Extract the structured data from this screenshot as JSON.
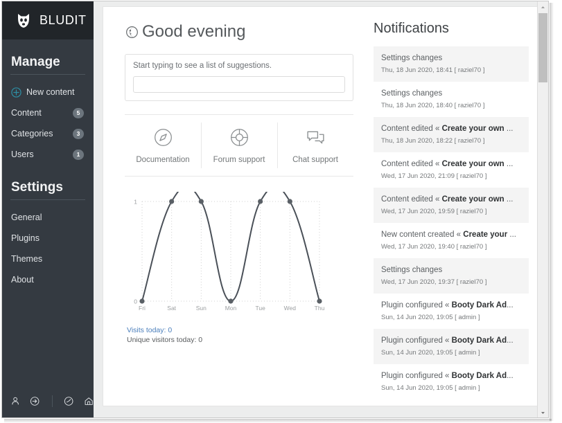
{
  "brand": {
    "name": "BLUDIT",
    "logo_icon": "dog-head-icon"
  },
  "sidebar": {
    "manage": {
      "title": "Manage",
      "items": [
        {
          "label": "New content",
          "icon": "plus-circle-icon",
          "badge": null,
          "accent": "#2d8fa5"
        },
        {
          "label": "Content",
          "icon": null,
          "badge": "5"
        },
        {
          "label": "Categories",
          "icon": null,
          "badge": "3"
        },
        {
          "label": "Users",
          "icon": null,
          "badge": "1"
        }
      ]
    },
    "settings": {
      "title": "Settings",
      "items": [
        {
          "label": "General"
        },
        {
          "label": "Plugins"
        },
        {
          "label": "Themes"
        },
        {
          "label": "About"
        }
      ]
    },
    "footer_icons": [
      {
        "name": "user-icon"
      },
      {
        "name": "logout-icon"
      },
      {
        "name": "divider"
      },
      {
        "name": "dashboard-icon"
      },
      {
        "name": "home-icon"
      }
    ]
  },
  "main": {
    "greeting": "Good evening",
    "greeting_icon": "moon-icon",
    "search": {
      "label": "Start typing to see a list of suggestions.",
      "value": "",
      "placeholder": ""
    },
    "support": [
      {
        "label": "Documentation",
        "icon": "compass-icon"
      },
      {
        "label": "Forum support",
        "icon": "life-ring-icon"
      },
      {
        "label": "Chat support",
        "icon": "chat-bubbles-icon"
      }
    ],
    "stats": {
      "visits_today": "Visits today: 0",
      "unique_today": "Unique visitors today: 0"
    }
  },
  "chart_data": {
    "type": "line",
    "title": "",
    "xlabel": "",
    "ylabel": "",
    "categories": [
      "Fri",
      "Sat",
      "Sun",
      "Mon",
      "Tue",
      "Wed",
      "Thu"
    ],
    "values": [
      0,
      1,
      1,
      0,
      1,
      1,
      0
    ],
    "ylim": [
      0,
      1
    ],
    "ytick_labels": [
      "0",
      "1"
    ],
    "grid": true,
    "legend": false,
    "line_color": "#4a5058",
    "point_color": "#5a6066"
  },
  "notifications": {
    "title": "Notifications",
    "items": [
      {
        "prefix": "Settings changes",
        "bold": "",
        "suffix": "",
        "meta": "Thu, 18 Jun 2020, 18:41 [ raziel70 ]"
      },
      {
        "prefix": "Settings changes",
        "bold": "",
        "suffix": "",
        "meta": "Thu, 18 Jun 2020, 18:40 [ raziel70 ]"
      },
      {
        "prefix": "Content edited « ",
        "bold": "Create your own",
        "suffix": " ...",
        "meta": "Thu, 18 Jun 2020, 18:22 [ raziel70 ]"
      },
      {
        "prefix": "Content edited « ",
        "bold": "Create your own",
        "suffix": " ...",
        "meta": "Wed, 17 Jun 2020, 21:09 [ raziel70 ]"
      },
      {
        "prefix": "Content edited « ",
        "bold": "Create your own",
        "suffix": " ...",
        "meta": "Wed, 17 Jun 2020, 19:59 [ raziel70 ]"
      },
      {
        "prefix": "New content created « ",
        "bold": "Create your",
        "suffix": " ...",
        "meta": "Wed, 17 Jun 2020, 19:40 [ raziel70 ]"
      },
      {
        "prefix": "Settings changes",
        "bold": "",
        "suffix": "",
        "meta": "Wed, 17 Jun 2020, 19:37 [ raziel70 ]"
      },
      {
        "prefix": "Plugin configured « ",
        "bold": "Booty Dark Ad",
        "suffix": "...",
        "meta": "Sun, 14 Jun 2020, 19:05 [ admin ]"
      },
      {
        "prefix": "Plugin configured « ",
        "bold": "Booty Dark Ad",
        "suffix": "...",
        "meta": "Sun, 14 Jun 2020, 19:05 [ admin ]"
      },
      {
        "prefix": "Plugin configured « ",
        "bold": "Booty Dark Ad",
        "suffix": "...",
        "meta": "Sun, 14 Jun 2020, 19:05 [ admin ]"
      }
    ]
  },
  "colors": {
    "sidebar_bg": "#343a41",
    "brand_bg": "#212529",
    "accent": "#2d8fa5",
    "link": "#4a7ebb",
    "badge_bg": "#6c757d",
    "page_bg": "#eceded"
  }
}
